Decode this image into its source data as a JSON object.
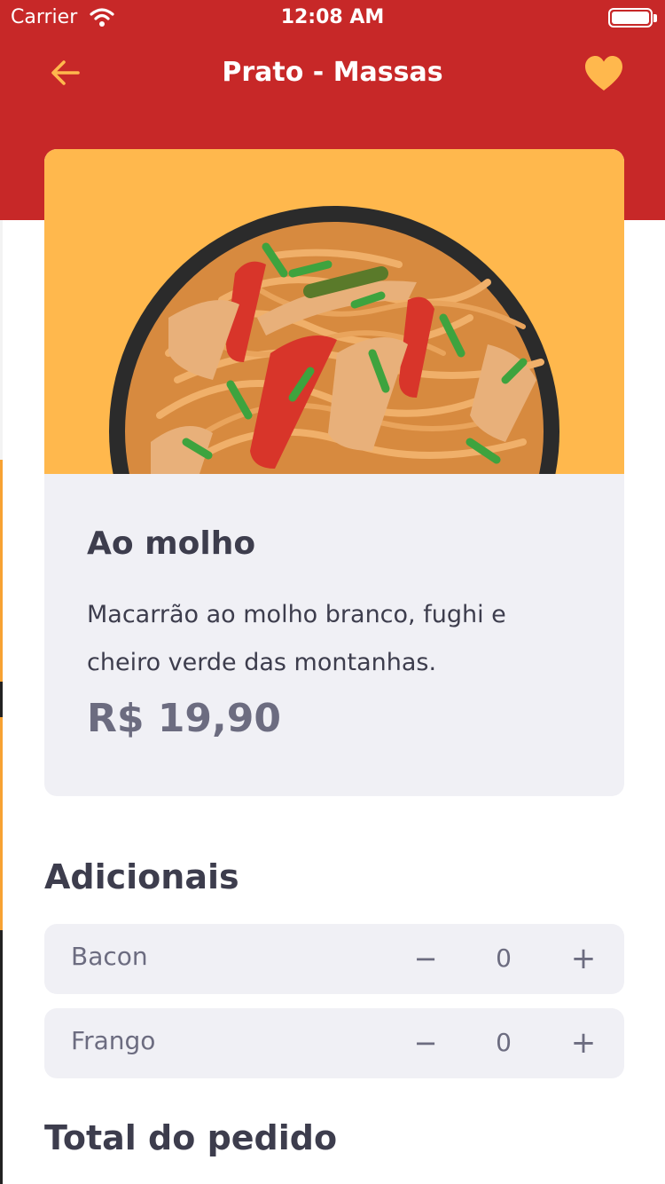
{
  "status_bar": {
    "carrier": "Carrier",
    "time": "12:08 AM"
  },
  "header": {
    "title": "Prato - Massas",
    "back_icon": "arrow-left-icon",
    "favorite_icon": "heart-icon"
  },
  "colors": {
    "header_bg": "#c72828",
    "accent": "#ffb84d",
    "card_bg": "#f0f0f5",
    "text": "#3d3d4d",
    "muted": "#6c6c80"
  },
  "dish": {
    "name": "Ao molho",
    "description": "Macarrão ao molho branco, fughi e cheiro verde das montanhas.",
    "price": "R$ 19,90"
  },
  "extras": {
    "title": "Adicionais",
    "items": [
      {
        "name": "Bacon",
        "quantity": "0",
        "minus": "−",
        "plus": "+"
      },
      {
        "name": "Frango",
        "quantity": "0",
        "minus": "−",
        "plus": "+"
      }
    ]
  },
  "total": {
    "title": "Total do pedido"
  }
}
